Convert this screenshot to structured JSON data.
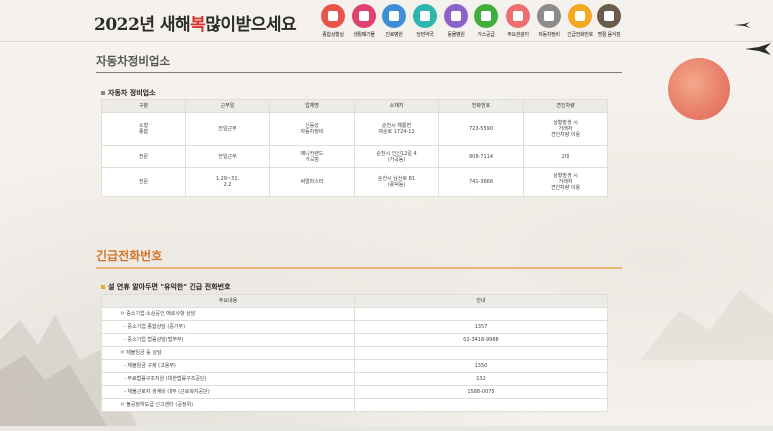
{
  "header": {
    "logo_prefix": "2022년 새해",
    "logo_accent": "복",
    "logo_suffix": "많이받으세요",
    "nav": [
      {
        "label": "종합상황실",
        "color": "#e8534a",
        "icon": "building-icon"
      },
      {
        "label": "생활폐기물",
        "color": "#e0426b",
        "icon": "trash-icon"
      },
      {
        "label": "진료병원",
        "color": "#3d8fd6",
        "icon": "hospital-icon"
      },
      {
        "label": "당번약국",
        "color": "#2fb6b0",
        "icon": "pharmacy-icon"
      },
      {
        "label": "동물병원",
        "color": "#8a63c9",
        "icon": "paw-icon"
      },
      {
        "label": "가스공급",
        "color": "#3fae3a",
        "icon": "gas-icon"
      },
      {
        "label": "주요관광지",
        "color": "#ee6f6f",
        "icon": "map-icon"
      },
      {
        "label": "자동차정비",
        "color": "#8c8c8c",
        "icon": "car-icon"
      },
      {
        "label": "긴급전화번호",
        "color": "#f5a623",
        "icon": "phone-icon"
      },
      {
        "label": "명절 음식점",
        "color": "#6b5b4b",
        "icon": "dining-icon"
      }
    ]
  },
  "section1": {
    "title": "자동차정비업소",
    "subtitle": "자동차 정비업소",
    "columns": [
      "구분",
      "근무일",
      "업체명",
      "소재지",
      "전화번호",
      "견인차량"
    ],
    "rows": [
      {
        "type": [
          "소형",
          "종합"
        ],
        "days": [
          "전일근무"
        ],
        "name": [
          "신동성",
          "자동차정비"
        ],
        "addr": [
          "순천시 해룡면",
          "여순로 1724-12"
        ],
        "phone": [
          "723-5590"
        ],
        "tow": [
          "상황발생 시",
          "거래처",
          "견인차량 이용"
        ]
      },
      {
        "type": [
          "전문"
        ],
        "days": [
          "전일근무"
        ],
        "name": [
          "매니카랜드",
          "가곡점"
        ],
        "addr": [
          "순천시 인신12길 4",
          "(가곡동)"
        ],
        "phone": [
          "908-7114"
        ],
        "tow": [
          "2대"
        ]
      },
      {
        "type": [
          "전문"
        ],
        "days": [
          "1.29~31,",
          "2.2"
        ],
        "name": [
          "써멀마스터"
        ],
        "addr": [
          "순천시 남산로 81",
          "(풍덕동)"
        ],
        "phone": [
          "741-3666"
        ],
        "tow": [
          "상황발생 시",
          "거래처",
          "견인차량 이용"
        ]
      }
    ]
  },
  "section2": {
    "title": "긴급전화번호",
    "subtitle": "설 연휴 알아두면 \"유익한\" 긴급 전화번호",
    "columns": [
      "주요내용",
      "안내"
    ],
    "rows": [
      {
        "content": "ㅇ 중소기업·소상공인 애로사항 상담",
        "info": "",
        "indent": false
      },
      {
        "content": "- 중소기업 종합상담 (중기부)",
        "info": "1357",
        "indent": true
      },
      {
        "content": "- 중소기업 법률상담(법무부)",
        "info": "02-3418-9988",
        "indent": true
      },
      {
        "content": "ㅇ 체불임금 등 상담",
        "info": "",
        "indent": false
      },
      {
        "content": "- 체불임금 구제 (고용부)",
        "info": "1350",
        "indent": true
      },
      {
        "content": "- 무료법률구조지원 (대한법률구조공단)",
        "info": "132",
        "indent": true
      },
      {
        "content": "- 체불근로자 생계비 대부 (근로복지공단)",
        "info": "1588-0075",
        "indent": true
      },
      {
        "content": "ㅇ 불공정하도급 신고센타 (공정위)",
        "info": "",
        "indent": false
      }
    ]
  }
}
